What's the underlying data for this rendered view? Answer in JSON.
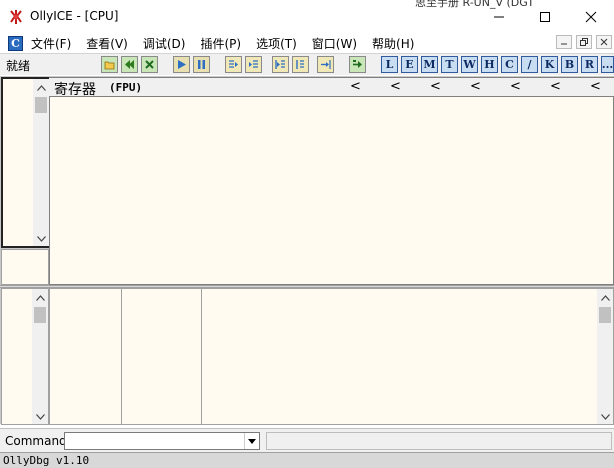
{
  "window": {
    "title": "OllyICE - [CPU]",
    "background_window_text": "思至手册 R-UN_V (DGT"
  },
  "menu": {
    "items": [
      "文件(F)",
      "查看(V)",
      "调试(D)",
      "插件(P)",
      "选项(T)",
      "窗口(W)",
      "帮助(H)"
    ]
  },
  "toolbar": {
    "status_text": "就绪",
    "letter_buttons": [
      "L",
      "E",
      "M",
      "T",
      "W",
      "H",
      "C",
      "/",
      "K",
      "B",
      "R",
      "..."
    ]
  },
  "registers": {
    "title": "寄存器",
    "mode": "(FPU)",
    "chevron": "<"
  },
  "command": {
    "label": "Command",
    "value": ""
  },
  "status": {
    "text": "OllyDbg v1.10"
  },
  "colors": {
    "pane_background": "#fffbf0",
    "letter_button_bg": "#c9ddf2",
    "letter_button_border": "#2f5a9e"
  }
}
